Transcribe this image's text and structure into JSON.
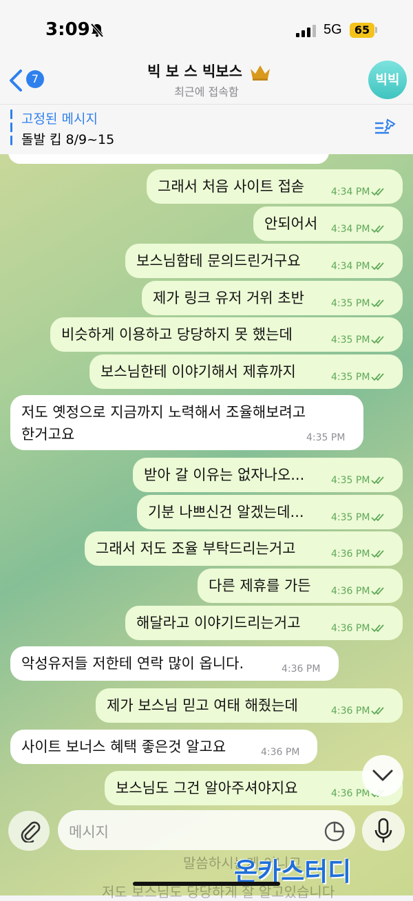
{
  "status": {
    "time": "3:09",
    "network": "5G",
    "battery": "65"
  },
  "header": {
    "back_count": "7",
    "title": "빅 보 스 빅보스",
    "subtitle": "최근에 접속함",
    "avatar_text": "빅빅"
  },
  "pinned": {
    "title": "고정된 메시지",
    "text": "돌발 킵 8/9~15"
  },
  "messages": [
    {
      "dir": "out",
      "text": "그래서 처음 사이트 접솓",
      "time": "4:34 PM"
    },
    {
      "dir": "out",
      "text": "안되어서",
      "time": "4:34 PM"
    },
    {
      "dir": "out",
      "text": "보스님함테 문의드린거구요",
      "time": "4:34 PM"
    },
    {
      "dir": "out",
      "text": "제가 링크 유저 거위 초반",
      "time": "4:35 PM"
    },
    {
      "dir": "out",
      "text": "비슷하게 이용하고 당당하지 못 했는데",
      "time": "4:35 PM"
    },
    {
      "dir": "out",
      "text": "보스님한테 이야기해서 제휴까지",
      "time": "4:35 PM"
    },
    {
      "dir": "in",
      "line1": "저도 옛정으로 지금까지 노력해서 조율해보려고",
      "line2": "한거고요",
      "time": "4:35 PM"
    },
    {
      "dir": "out",
      "text": "받아 갈 이유는 없자나오...",
      "time": "4:35 PM"
    },
    {
      "dir": "out",
      "text": "기분 나쁘신건 알겠는데...",
      "time": "4:35 PM"
    },
    {
      "dir": "out",
      "text": "그래서 저도 조율 부탁드리는거고",
      "time": "4:36 PM"
    },
    {
      "dir": "out",
      "text": "다른 제휴를 가든",
      "time": "4:36 PM"
    },
    {
      "dir": "out",
      "text": "해달라고 이야기드리는거고",
      "time": "4:36 PM"
    },
    {
      "dir": "in",
      "text": "악성유저들 저한테 연락 많이 옵니다.",
      "time": "4:36 PM"
    },
    {
      "dir": "out",
      "text": "제가 보스님 믿고 여태 해줬는데",
      "time": "4:36 PM"
    },
    {
      "dir": "in",
      "text": "사이트 보너스 혜택 좋은것 알고요",
      "time": "4:36 PM"
    },
    {
      "dir": "out",
      "text": "보스님도 그건 알아주셔야지요",
      "time": "4:36 PM"
    }
  ],
  "input": {
    "placeholder": "메시지"
  },
  "ghost_text": {
    "line1": "말씀하시는게 이니고",
    "line2": "저도 보스님도 당당하게 잘 알고있습니다"
  },
  "watermark": "온카스터디",
  "colors": {
    "accent": "#2f80ed",
    "outgoing_bubble": "#ecfad5",
    "incoming_bubble": "#ffffff",
    "check": "#5fa85a"
  },
  "icons": [
    "bell-slash-icon",
    "signal-icon",
    "back-chevron-icon",
    "crown-icon",
    "pin-list-icon",
    "double-check-icon",
    "paperclip-icon",
    "sticker-icon",
    "microphone-icon",
    "chevron-down-icon"
  ]
}
